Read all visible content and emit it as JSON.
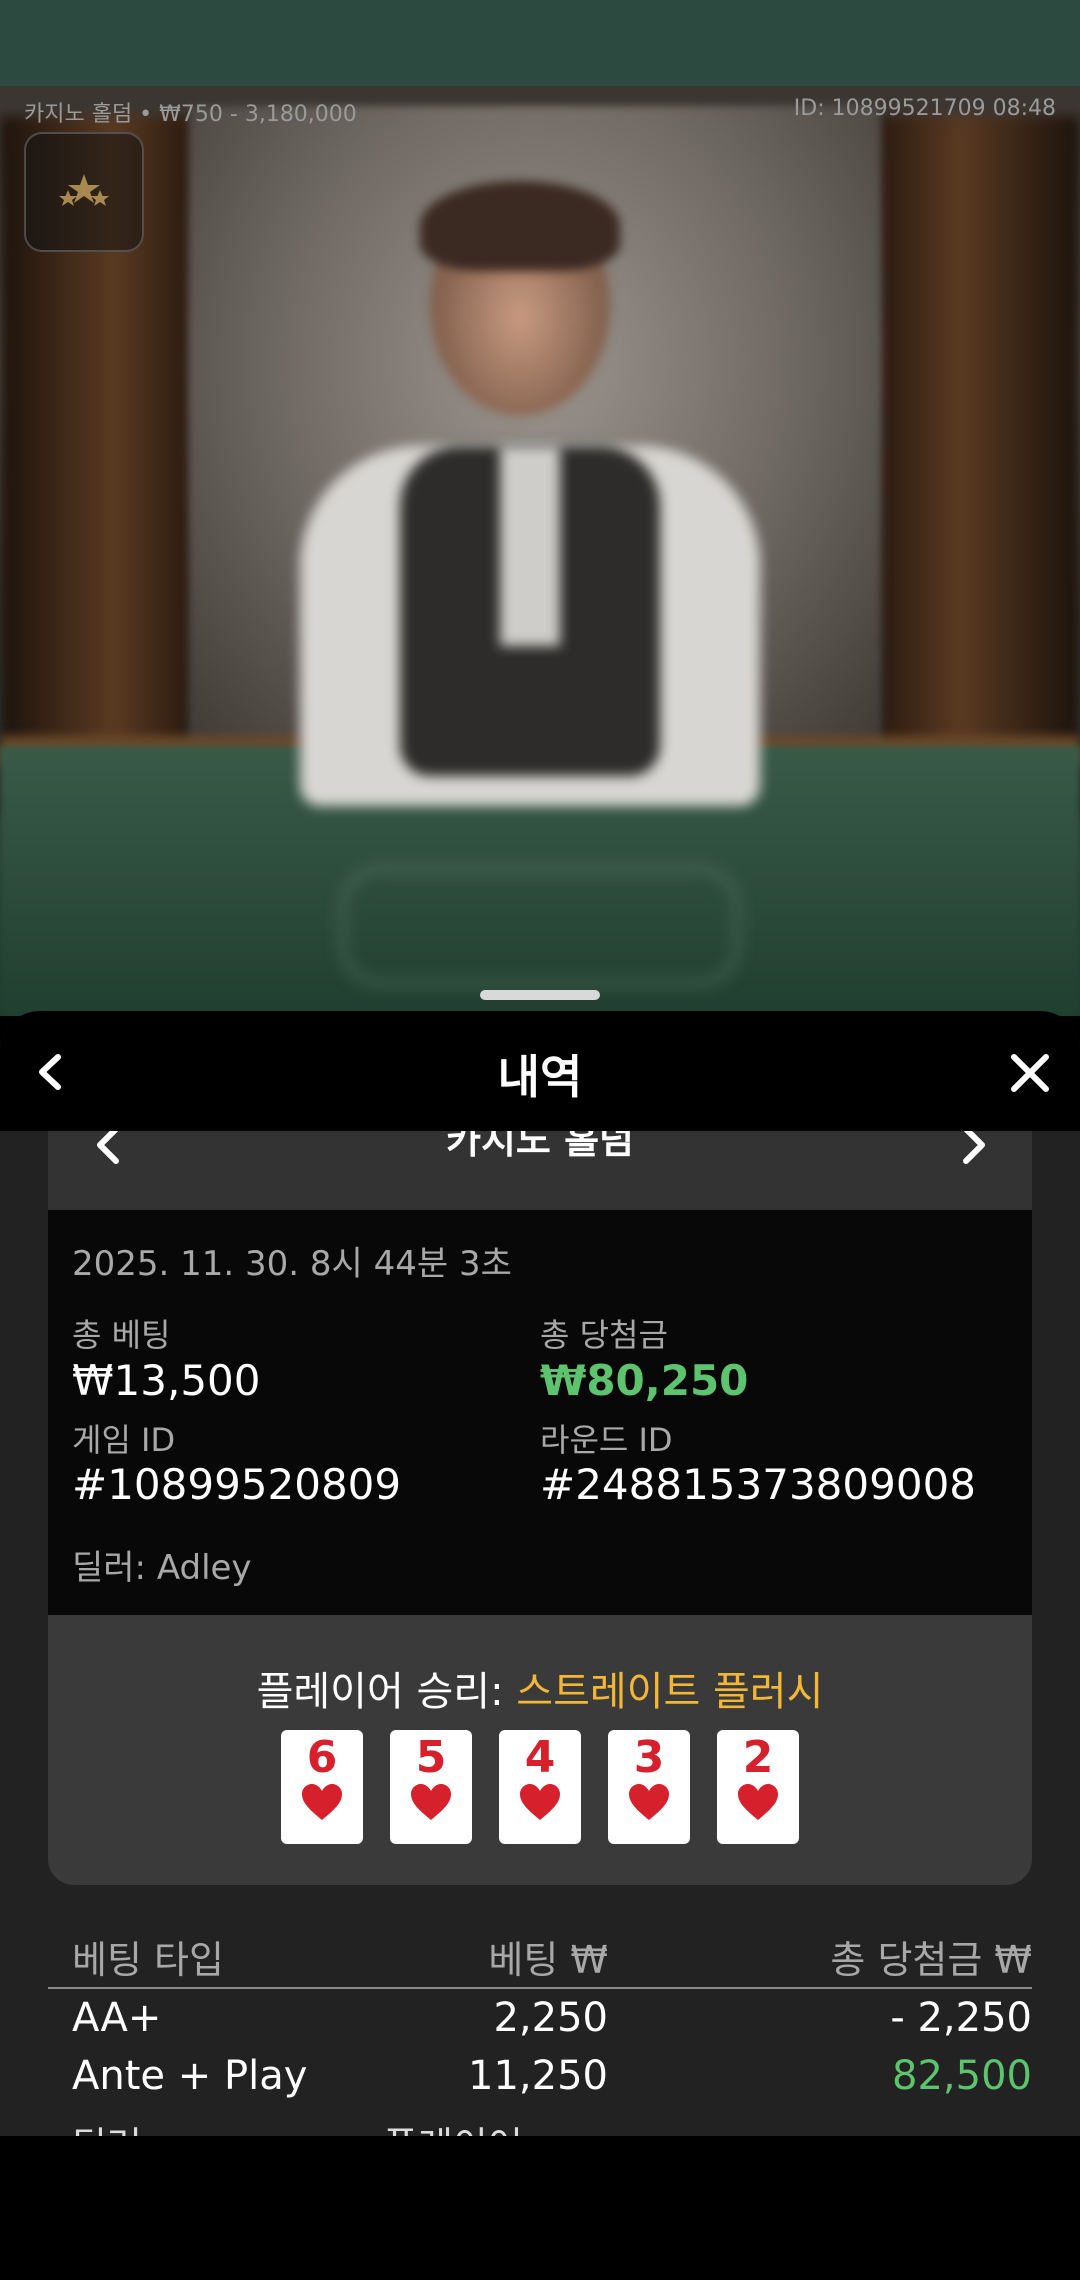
{
  "game_info": {
    "table_label": "카지노 홀덤 • ₩750 - 3,180,000",
    "id_time": "ID: 10899521709 08:48"
  },
  "sheet": {
    "title": "내역"
  },
  "history": {
    "game_name": "카지노 홀덤",
    "datetime": "2025. 11. 30. 8시 44분 3초",
    "total_bet_label": "총 베팅",
    "total_bet_value": "₩13,500",
    "total_win_label": "총 당첨금",
    "total_win_value": "₩80,250",
    "game_id_label": "게임 ID",
    "game_id_value": "#10899520809",
    "round_id_label": "라운드 ID",
    "round_id_value": "#248815373809008",
    "dealer_line": "딜러: Adley",
    "result_prefix": "플레이어 승리: ",
    "result_hand": "스트레이트 플러시",
    "cards": [
      {
        "rank": "6",
        "suit": "heart"
      },
      {
        "rank": "5",
        "suit": "heart"
      },
      {
        "rank": "4",
        "suit": "heart"
      },
      {
        "rank": "3",
        "suit": "heart"
      },
      {
        "rank": "2",
        "suit": "heart"
      }
    ]
  },
  "bets_table": {
    "headers": [
      "베팅 타입",
      "베팅 ₩",
      "총 당첨금 ₩"
    ],
    "rows": [
      {
        "type": "AA+",
        "bet": "2,250",
        "win": "- 2,250"
      },
      {
        "type": "Ante + Play",
        "bet": "11,250",
        "win": "82,500"
      }
    ],
    "partial_dealer": "딜러:",
    "partial_player": "플레이어:"
  },
  "colors": {
    "win_green": "#5dc36e",
    "hand_gold": "#f2b736",
    "card_red": "#d6202c",
    "topbar": "#2d4a40"
  }
}
